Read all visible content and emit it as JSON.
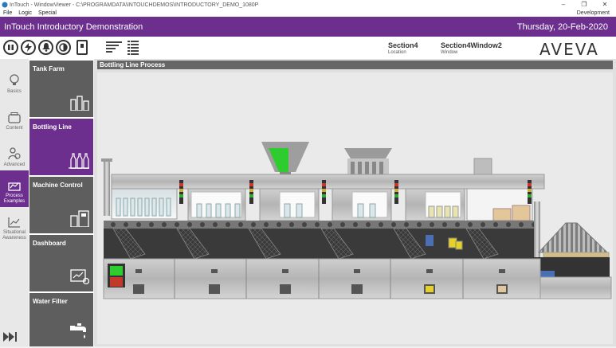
{
  "window": {
    "title": "InTouch - WindowViewer - C:\\PROGRAMDATA\\INTOUCHDEMOS\\INTRODUCTORY_DEMO_1080P",
    "controls": [
      "–",
      "❐",
      "✕"
    ]
  },
  "menu": {
    "items": [
      "File",
      "Logic",
      "Special"
    ],
    "right_label": "Development"
  },
  "header": {
    "title": "InTouch Introductory Demonstration",
    "date": "Thursday, 20-Feb-2020"
  },
  "toolbar": {
    "location_value": "Section4",
    "location_label": "Location",
    "window_value": "Section4Window2",
    "window_label": "Window",
    "logo": "AVEVA"
  },
  "nav_primary": {
    "items": [
      {
        "label": "Basics",
        "icon": "lightbulb-icon"
      },
      {
        "label": "Content",
        "icon": "content-icon"
      },
      {
        "label": "Advanced",
        "icon": "advanced-icon"
      },
      {
        "label": "Process Examples",
        "icon": "process-icon",
        "active": true
      },
      {
        "label": "Situational Awareness",
        "icon": "chart-icon"
      }
    ]
  },
  "nav_secondary": {
    "items": [
      {
        "label": "Tank Farm",
        "icon": "tank-farm-icon"
      },
      {
        "label": "Bottling Line",
        "icon": "bottles-icon",
        "active": true
      },
      {
        "label": "Machine Control",
        "icon": "machine-icon"
      },
      {
        "label": "Dashboard",
        "icon": "dashboard-icon"
      },
      {
        "label": "Water Filter",
        "icon": "faucet-icon"
      }
    ]
  },
  "main": {
    "section_title": "Bottling Line Process"
  },
  "colors": {
    "brand_purple": "#6c2f8e",
    "hopper_fill": "#2ecc2e",
    "run_indicator": "#2ecc2e",
    "stop_indicator": "#c0392b"
  }
}
